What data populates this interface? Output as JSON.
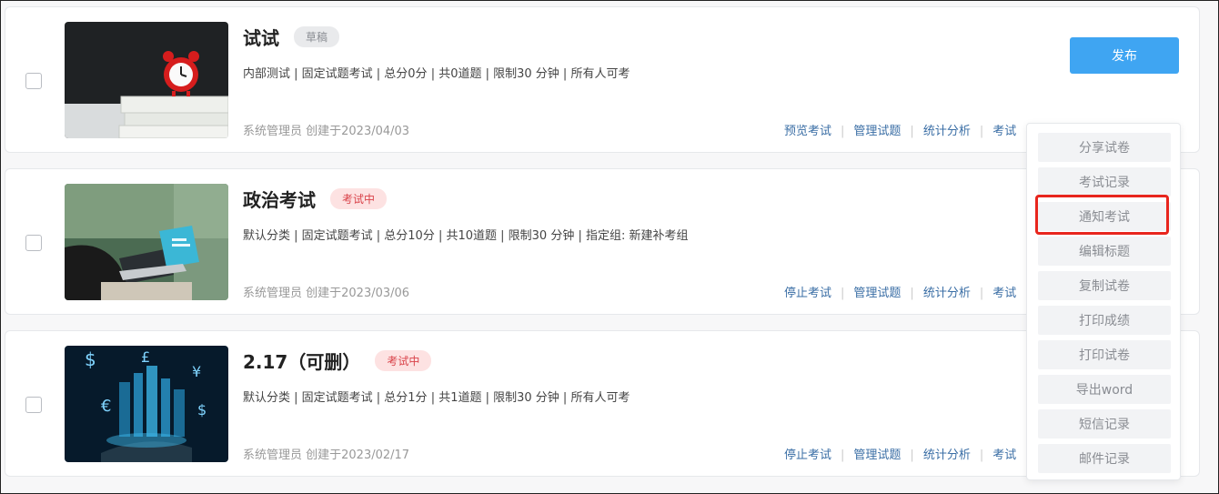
{
  "exams": [
    {
      "title": "试试",
      "status": "草稿",
      "meta": "内部测试 | 固定试题考试 | 总分0分 | 共0道题 | 限制30 分钟 | 所有人可考",
      "creator": "系统管理员 创建于2023/04/03",
      "actions": [
        "预览考试",
        "管理试题",
        "统计分析",
        "考试"
      ],
      "publish_label": "发布",
      "thumbnail": "alarm-clock-on-books"
    },
    {
      "title": "政治考试",
      "status": "考试中",
      "meta": "默认分类 | 固定试题考试 | 总分10分 | 共10道题 | 限制30 分钟 | 指定组: 新建补考组",
      "creator": "系统管理员 创建于2023/03/06",
      "actions": [
        "停止考试",
        "管理试题",
        "统计分析",
        "考试"
      ],
      "thumbnail": "person-with-laptop"
    },
    {
      "title": "2.17（可删）",
      "status": "考试中",
      "meta": "默认分类 | 固定试题考试 | 总分1分 | 共1道题 | 限制30 分钟 | 所有人可考",
      "creator": "系统管理员 创建于2023/02/17",
      "actions": [
        "停止考试",
        "管理试题",
        "统计分析",
        "考试"
      ],
      "thumbnail": "currency-hologram"
    }
  ],
  "dropdown_menu": [
    "分享试卷",
    "考试记录",
    "通知考试",
    "编辑标题",
    "复制试卷",
    "打印成绩",
    "打印试卷",
    "导出word",
    "短信记录",
    "邮件记录"
  ],
  "highlighted_item": "通知考试",
  "colors": {
    "primary": "#3fa5f2",
    "link": "#3a6ea5",
    "live_badge": "#d9434a",
    "highlight": "#e8251d"
  }
}
